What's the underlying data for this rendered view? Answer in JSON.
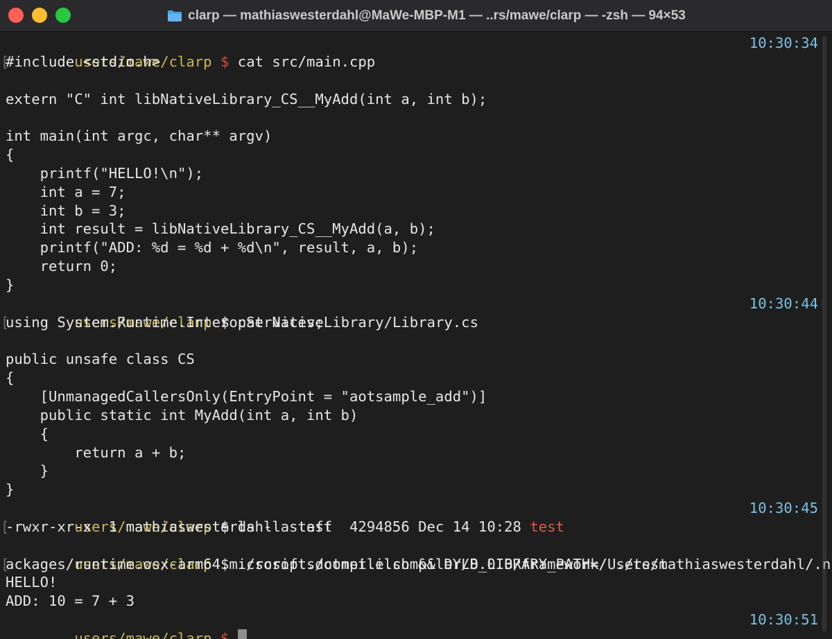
{
  "window": {
    "title": "clarp — mathiaswesterdahl@MaWe-MBP-M1 — ..rs/mawe/clarp — -zsh — 94×53",
    "folder_icon": "folder-icon",
    "colors": {
      "close": "#ff5f57",
      "minimize": "#febc2e",
      "zoom": "#28c840",
      "path": "#c9b85a",
      "time": "#78c3e6",
      "prompt_red": "#d24b3a"
    }
  },
  "terminal": {
    "prompts": [
      {
        "path": "users/mawe/clarp",
        "symbol": "$",
        "command": " cat src/main.cpp",
        "time": "10:30:34"
      },
      {
        "path": "users/mawe/clarp",
        "symbol": "$",
        "command": " cat NativeLibrary/Library.cs",
        "time": "10:30:44"
      },
      {
        "path": "users/mawe/clarp",
        "symbol": "$",
        "command": " ls -la test",
        "time": "10:30:45"
      },
      {
        "path": "users/mawe/clarp",
        "symbol": "$",
        "command": " ./scripts/compile.sh && DYLD_LIBRARY_PATH=/Users/mathiaswesterdahl/.nuget/p",
        "time": ""
      },
      {
        "path": "users/mawe/clarp",
        "symbol": "$",
        "command": " ",
        "time": "10:30:51"
      }
    ],
    "main_cpp": [
      "#include <stdio.h>",
      "",
      "extern \"C\" int libNativeLibrary_CS__MyAdd(int a, int b);",
      "",
      "int main(int argc, char** argv)",
      "{",
      "    printf(\"HELLO!\\n\");",
      "    int a = 7;",
      "    int b = 3;",
      "    int result = libNativeLibrary_CS__MyAdd(a, b);",
      "    printf(\"ADD: %d = %d + %d\\n\", result, a, b);",
      "    return 0;",
      "}"
    ],
    "library_cs": [
      "using System.Runtime.InteropServices;",
      "",
      "public unsafe class CS",
      "{",
      "    [UnmanagedCallersOnly(EntryPoint = \"aotsample_add\")]",
      "    public static int MyAdd(int a, int b)",
      "    {",
      "        return a + b;",
      "    }",
      "}"
    ],
    "ls_output": {
      "prefix": "-rwxr-xr-x  1 mathiaswesterdahl  staff  4294856 Dec 14 10:28 ",
      "file": "test"
    },
    "run_output": [
      "ackages/runtime.osx-arm64.microsoft.dotnet.ilcompiler/8.0.0/framework/ ./test",
      "HELLO!",
      "ADD: 10 = 7 + 3"
    ]
  }
}
